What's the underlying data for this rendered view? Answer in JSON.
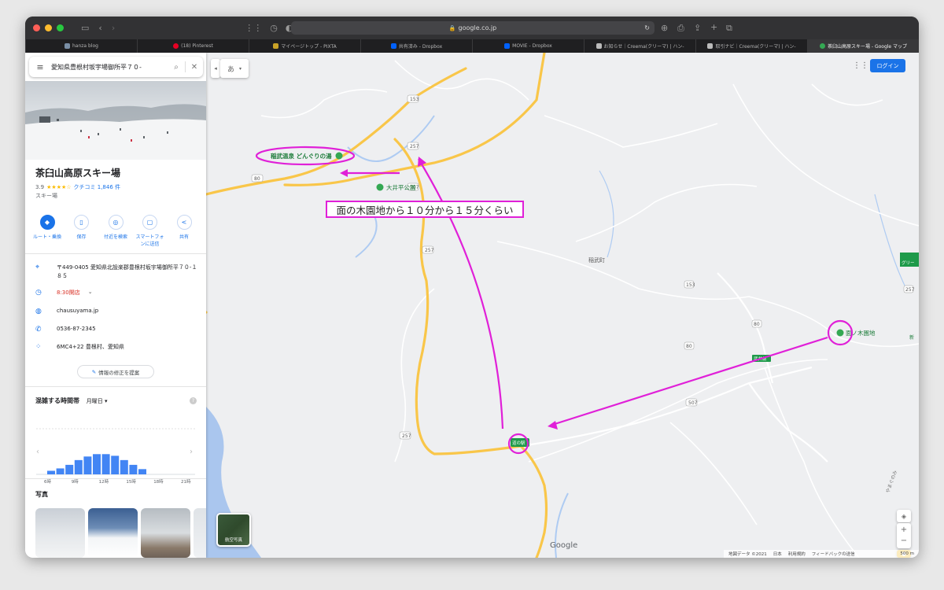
{
  "browser": {
    "url": "google.co.jp",
    "tabs": [
      {
        "label": "hanza blog",
        "color": "#7a8fa6"
      },
      {
        "label": "(18) Pinterest",
        "color": "#e60023"
      },
      {
        "label": "マイページトップ - PIXTA",
        "color": "#c9a227"
      },
      {
        "label": "共有済み - Dropbox",
        "color": "#0061fe"
      },
      {
        "label": "MOVIE - Dropbox",
        "color": "#0061fe"
      },
      {
        "label": "お知らせ｜Creema(クリーマ) | ハン-",
        "color": "#bbbbbb"
      },
      {
        "label": "取引ナビ｜Creema(クリーマ) | ハン-",
        "color": "#bbbbbb"
      },
      {
        "label": "茶臼山高原スキー場 - Google マップ",
        "color": "#34a853"
      }
    ]
  },
  "search": {
    "value": "愛知県豊根村坂宇場御所平７０-"
  },
  "ime_toggle": "あ",
  "place": {
    "title": "茶臼山高原スキー場",
    "rating": "3.9",
    "stars": "★★★★☆",
    "reviews": "クチコミ 1,846 件",
    "category": "スキー場"
  },
  "actions": [
    {
      "label": "ルート・乗換",
      "icon": "◆",
      "primary": true
    },
    {
      "label": "保存",
      "icon": "▯",
      "primary": false
    },
    {
      "label": "付近を検索",
      "icon": "◎",
      "primary": false
    },
    {
      "label": "スマートフォンに送信",
      "icon": "▢",
      "primary": false
    },
    {
      "label": "共有",
      "icon": "<",
      "primary": false
    }
  ],
  "info": {
    "address": "〒449-0405 愛知県北設楽郡豊根村坂宇場御所平７０-１８５",
    "hours": "8:30開店",
    "website": "chausuyama.jp",
    "phone": "0536-87-2345",
    "plus_code": "6MC4+22 豊根村、愛知県",
    "suggest_edit": "情報の修正を提案"
  },
  "popular_times": {
    "title": "混雑する時間帯",
    "day": "月曜日",
    "hour_labels": [
      "6時",
      "9時",
      "12時",
      "15時",
      "18時",
      "21時"
    ]
  },
  "chart_data": {
    "type": "bar",
    "title": "",
    "x": [
      6,
      7,
      8,
      9,
      10,
      11,
      12,
      13,
      14,
      15,
      16
    ],
    "values": [
      15,
      25,
      40,
      60,
      75,
      85,
      85,
      78,
      60,
      40,
      22
    ],
    "ylim": [
      0,
      100
    ]
  },
  "photos_title": "写真",
  "map": {
    "login_label": "ログイン",
    "aerial_label": "航空写真",
    "google_logo": "Google",
    "attribution": [
      "地図データ ©2021",
      "日本",
      "利用規約",
      "フィードバックの送信",
      "500 m"
    ],
    "poi": {
      "onsen": "稲武温泉 どんぐりの湯",
      "park": "大井平公園",
      "menoki": "面ノ木園地",
      "town": "稲武町",
      "michi": "道の駅",
      "edge_label": "新",
      "green_label": "グリー",
      "small_label": "武井前",
      "side_label": "やまぐのみ"
    },
    "roads": [
      "153",
      "257",
      "80",
      "507",
      "257",
      "153",
      "80",
      "257",
      "80",
      "507",
      "257"
    ],
    "annotation": "面の木園地から１０分から１５分くらい",
    "annotation_color": "#e020d8"
  }
}
